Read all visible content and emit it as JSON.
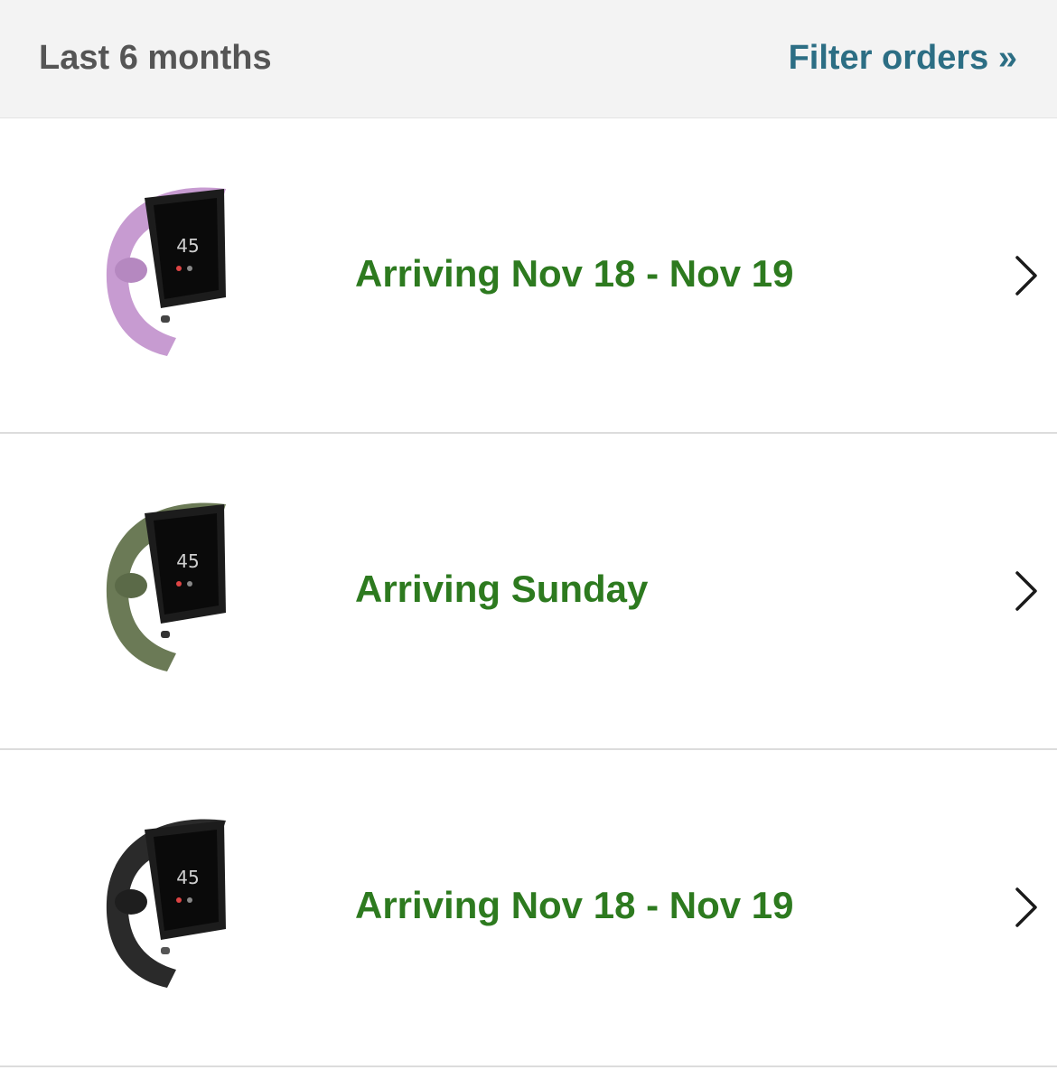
{
  "header": {
    "range_label": "Last 6 months",
    "filter_label": "Filter orders »"
  },
  "orders": [
    {
      "status": "Arriving Nov 18 - Nov 19",
      "band_color": "#c79bd1",
      "product_icon": "fitness-band-lavender"
    },
    {
      "status": "Arriving Sunday",
      "band_color": "#6b7a56",
      "product_icon": "fitness-band-olive"
    },
    {
      "status": "Arriving Nov 18 - Nov 19",
      "band_color": "#2a2a2a",
      "product_icon": "fitness-band-black"
    }
  ],
  "screen_text": {
    "time_display": "45"
  },
  "colors": {
    "status_green": "#2d7a1f",
    "link_teal": "#2c6e84",
    "header_bg": "#f3f3f3"
  }
}
